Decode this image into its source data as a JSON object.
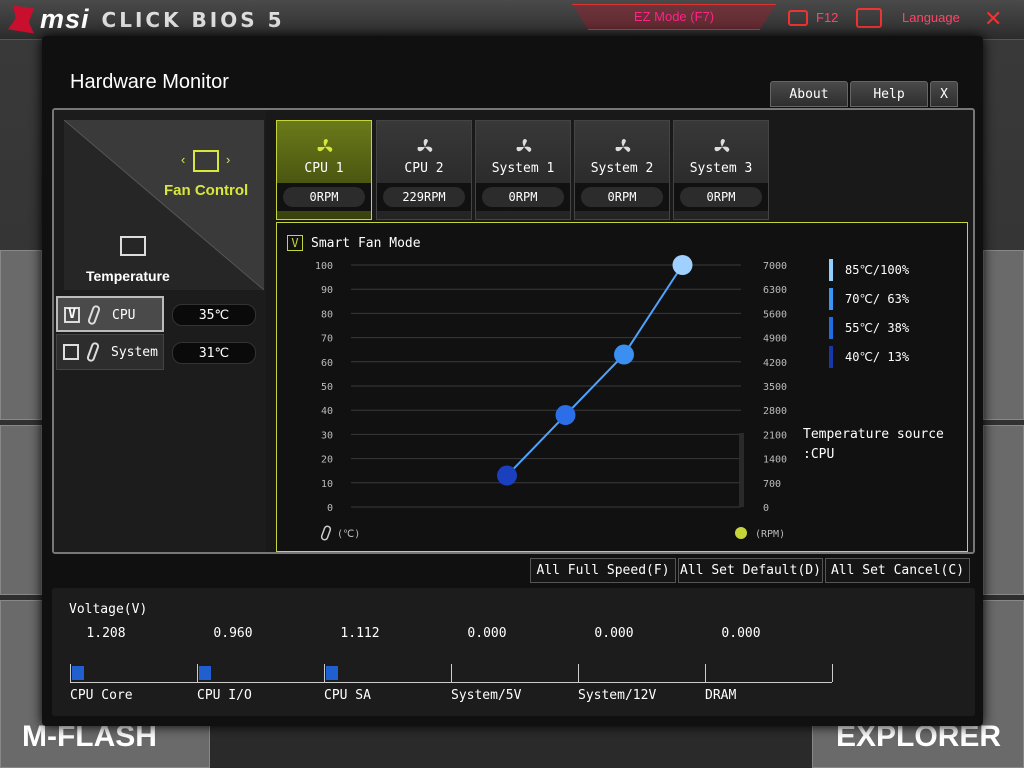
{
  "bios": {
    "brand": "msi",
    "product": "CLICK BIOS 5",
    "ez_mode": "EZ Mode (F7)",
    "f12": "F12",
    "language": "Language",
    "close": "✕",
    "bg_mflash": "M-FLASH",
    "bg_explorer": "EXPLORER"
  },
  "modal": {
    "title": "Hardware Monitor",
    "about": "About",
    "help": "Help",
    "close": "X"
  },
  "left": {
    "fan_control": "Fan Control",
    "arrow_left": "‹",
    "arrow_right": "›",
    "temperature": "Temperature",
    "sources": [
      {
        "name": "CPU",
        "value": "35℃",
        "checked": true,
        "check": "V"
      },
      {
        "name": "System",
        "value": "31℃",
        "checked": false,
        "check": ""
      }
    ]
  },
  "fans": [
    {
      "name": "CPU 1",
      "rpm": "0RPM",
      "active": true
    },
    {
      "name": "CPU 2",
      "rpm": "229RPM",
      "active": false
    },
    {
      "name": "System 1",
      "rpm": "0RPM",
      "active": false
    },
    {
      "name": "System 2",
      "rpm": "0RPM",
      "active": false
    },
    {
      "name": "System 3",
      "rpm": "0RPM",
      "active": false
    }
  ],
  "smart_fan": {
    "label": "Smart Fan Mode",
    "check": "V"
  },
  "chart_data": {
    "type": "line",
    "y_left_ticks": [
      "100",
      "90",
      "80",
      "70",
      "60",
      "50",
      "40",
      "30",
      "20",
      "10",
      "0"
    ],
    "y_right_ticks": [
      "7000",
      "6300",
      "5600",
      "4900",
      "4200",
      "3500",
      "2800",
      "2100",
      "1400",
      "700",
      "0"
    ],
    "ylim": [
      0,
      100
    ],
    "xlim": [
      0,
      100
    ],
    "x_unit": "(℃)",
    "y_unit": "(RPM)",
    "points": [
      {
        "temp": 40,
        "pct": 13,
        "color": "#1a3fbf"
      },
      {
        "temp": 55,
        "pct": 38,
        "color": "#2a6ee8"
      },
      {
        "temp": 70,
        "pct": 63,
        "color": "#3b8ff0"
      },
      {
        "temp": 85,
        "pct": 100,
        "color": "#9fd0ff"
      }
    ],
    "legend": [
      {
        "text": "85℃/100%",
        "color": "#8fd0ff"
      },
      {
        "text": "70℃/ 63%",
        "color": "#3a96f5"
      },
      {
        "text": "55℃/ 38%",
        "color": "#1f6de0"
      },
      {
        "text": "40℃/ 13%",
        "color": "#1638a8"
      }
    ],
    "temp_source": "Temperature source\n:CPU",
    "grid": true
  },
  "actions": {
    "full_speed": "All Full Speed(F)",
    "set_default": "All Set Default(D)",
    "set_cancel": "All Set Cancel(C)"
  },
  "voltage": {
    "title": "Voltage(V)",
    "items": [
      {
        "label": "CPU Core",
        "value": "1.208",
        "fill": 0.1
      },
      {
        "label": "CPU I/O",
        "value": "0.960",
        "fill": 0.1
      },
      {
        "label": "CPU SA",
        "value": "1.112",
        "fill": 0.1
      },
      {
        "label": "System/5V",
        "value": "0.000",
        "fill": 0
      },
      {
        "label": "System/12V",
        "value": "0.000",
        "fill": 0
      },
      {
        "label": "DRAM",
        "value": "0.000",
        "fill": 0
      }
    ]
  }
}
